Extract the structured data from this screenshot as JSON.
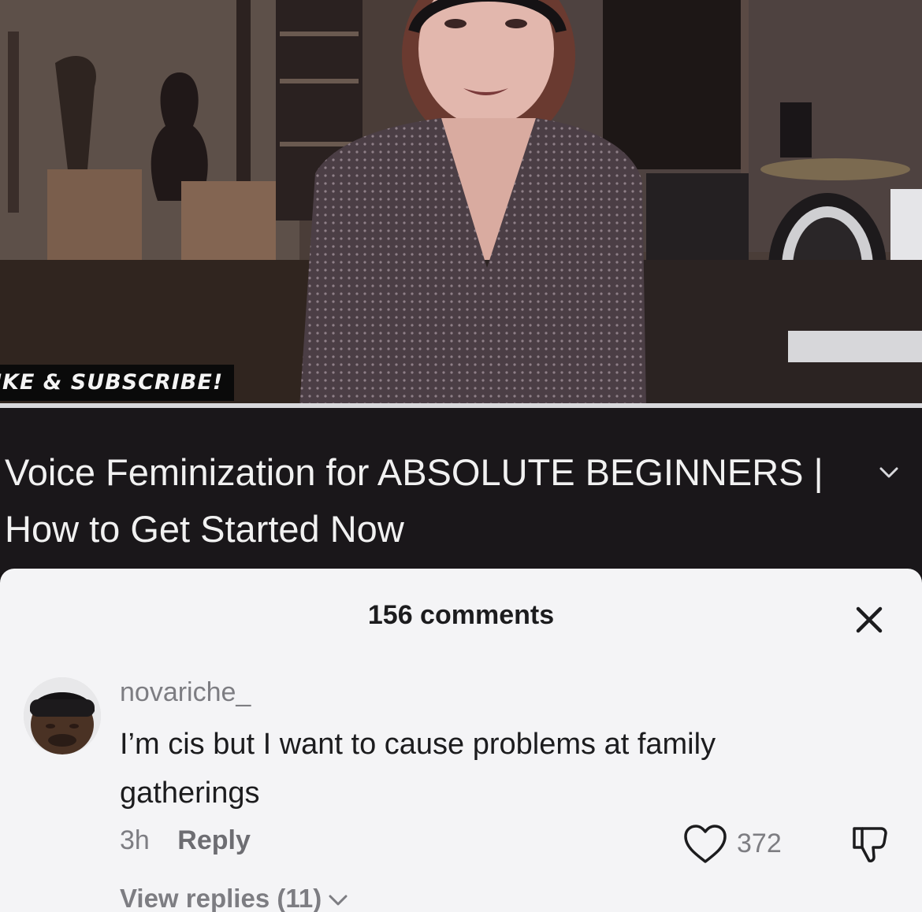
{
  "video": {
    "banner_text": "IKE & SUBSCRIBE!",
    "progress_fraction": 1.0,
    "title": "Voice Feminization for ABSOLUTE BEGINNERS | How to Get Started Now"
  },
  "comments_sheet": {
    "count_label": "156 comments",
    "close_icon": "close-icon",
    "comment": {
      "username": "novariche_",
      "text": "I’m cis but I want to cause problems at family gatherings",
      "time": "3h",
      "reply_label": "Reply",
      "like_count": "372",
      "like_icon": "heart-outline-icon",
      "dislike_icon": "thumbs-down-icon",
      "view_replies_label": "View replies (11)"
    }
  },
  "colors": {
    "sheet_background": "#f4f4f6",
    "title_strip_background": "#1a171a",
    "secondary_text": "#7d7d82",
    "primary_text": "#1c1c1e"
  }
}
